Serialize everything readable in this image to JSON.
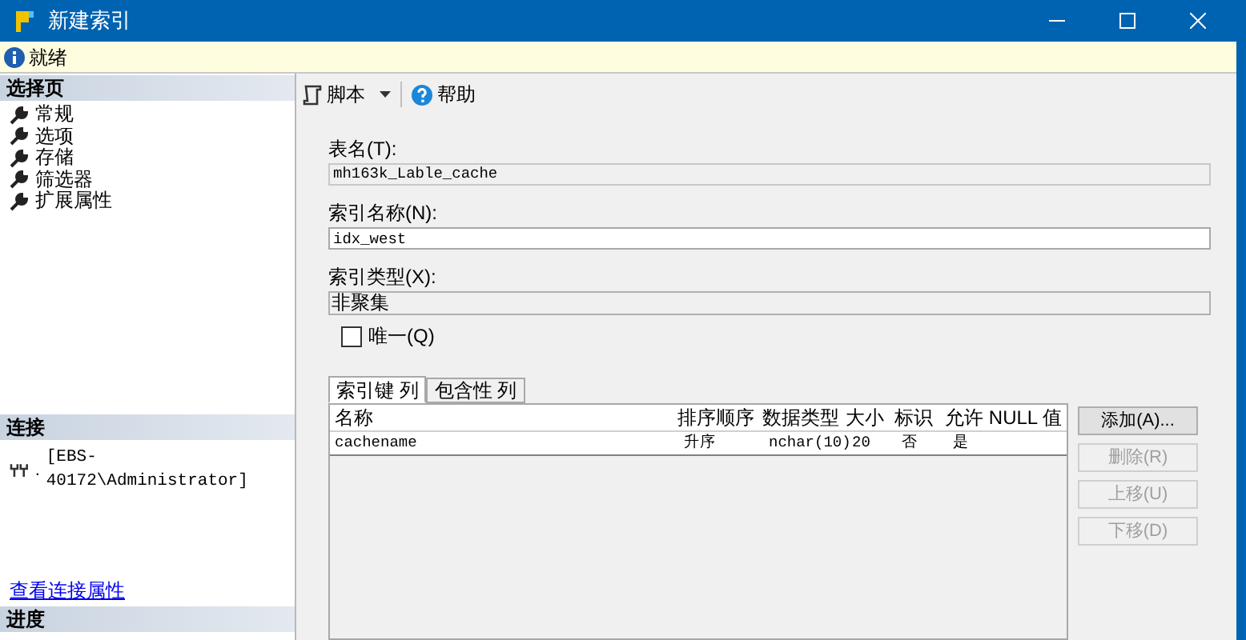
{
  "window": {
    "title": "新建索引"
  },
  "status_bar": {
    "text": "就绪"
  },
  "sidebar": {
    "pages_header": "选择页",
    "items": [
      {
        "label": "常规",
        "selected": false
      },
      {
        "label": "选项",
        "selected": false
      },
      {
        "label": "存储",
        "selected": false
      },
      {
        "label": "筛选器",
        "selected": false
      },
      {
        "label": "扩展属性",
        "selected": false
      }
    ],
    "connection_header": "连接",
    "connection": {
      "separator": ".",
      "text": "[EBS-40172\\Administrator]"
    },
    "connection_link": "查看连接属性",
    "progress_header": "进度"
  },
  "toolbar": {
    "script": "脚本",
    "help": "帮助"
  },
  "form": {
    "table_name": {
      "label": "表名(T):",
      "value": "mh163k_Lable_cache"
    },
    "index_name": {
      "label": "索引名称(N):",
      "value": "idx_west"
    },
    "index_type": {
      "label": "索引类型(X):",
      "value": "非聚集"
    },
    "unique": {
      "label": "唯一(Q)",
      "checked": false
    }
  },
  "tabs": [
    {
      "label": "索引键 列",
      "selected": true
    },
    {
      "label": "包含性 列",
      "selected": false
    }
  ],
  "table": {
    "columns": [
      "名称",
      "排序顺序",
      "数据类型",
      "大小",
      "标识",
      "允许 NULL 值"
    ],
    "rows": [
      [
        "cachename",
        "升序",
        "nchar(10)",
        "20",
        "否",
        "是"
      ]
    ]
  },
  "buttons": [
    {
      "label": "添加(A)...",
      "disabled": false
    },
    {
      "label": "删除(R)",
      "disabled": true
    },
    {
      "label": "上移(U)",
      "disabled": true
    },
    {
      "label": "下移(D)",
      "disabled": true
    }
  ]
}
